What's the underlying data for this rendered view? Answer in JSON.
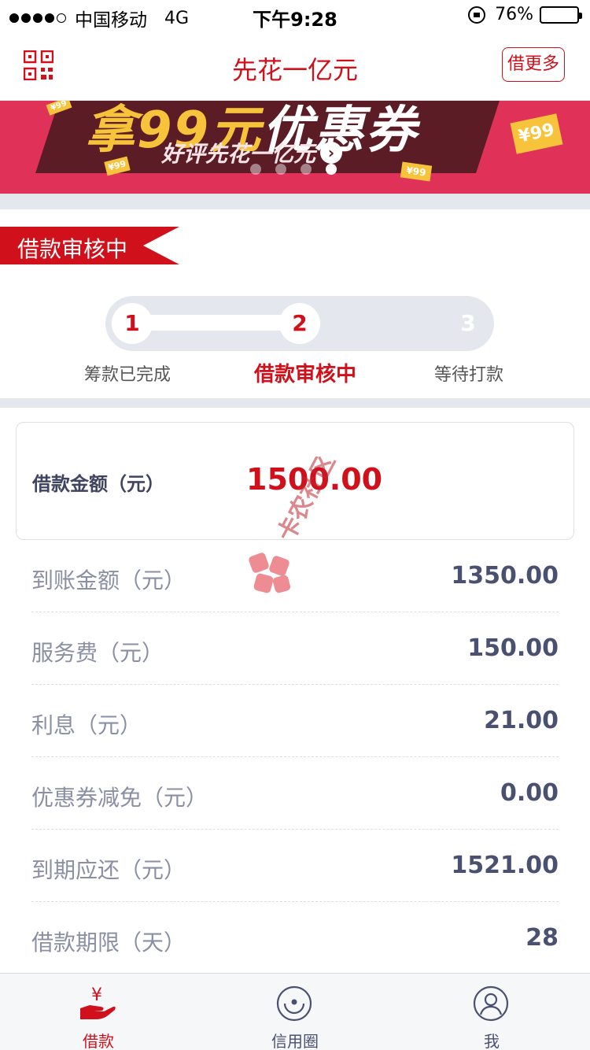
{
  "status_bar": {
    "carrier": "中国移动",
    "network": "4G",
    "time": "下午9:28",
    "battery": "76%",
    "battery_level": 0.76,
    "signal_bars_filled": 4,
    "signal_bars_total": 5
  },
  "nav": {
    "title": "先花一亿元",
    "more_button": "借更多",
    "left_icon": "qr-code-icon"
  },
  "banner": {
    "headline_prefix": "拿99元",
    "headline_suffix": "优惠券",
    "subline": "好评先花一亿元",
    "coupon_big": "¥99",
    "coupon_small": "¥99",
    "page_count": 4,
    "active_page": 4
  },
  "loan_status": {
    "ribbon": "借款审核中",
    "steps": [
      {
        "number": "1",
        "label": "筹款已完成"
      },
      {
        "number": "2",
        "label": "借款审核中"
      },
      {
        "number": "3",
        "label": "等待打款"
      }
    ],
    "current_step": 2
  },
  "amount": {
    "label": "借款金额（元）",
    "value": "1500.00"
  },
  "details": [
    {
      "label": "到账金额（元）",
      "value": "1350.00"
    },
    {
      "label": "服务费（元）",
      "value": "150.00"
    },
    {
      "label": "利息（元）",
      "value": "21.00"
    },
    {
      "label": "优惠券减免（元）",
      "value": "0.00"
    },
    {
      "label": "到期应还（元）",
      "value": "1521.00"
    },
    {
      "label": "借款期限（天）",
      "value": "28"
    }
  ],
  "watermark": "卡农社区",
  "tab_bar": [
    {
      "label": "借款",
      "icon": "yuan-hand-icon",
      "active": true
    },
    {
      "label": "信用圈",
      "icon": "credit-circle-icon",
      "active": false
    },
    {
      "label": "我",
      "icon": "user-icon",
      "active": false
    }
  ],
  "colors": {
    "accent": "#d0111b",
    "banner_bg": "#e03259",
    "banner_stripe": "#5b1c25",
    "gold": "#f6c33a",
    "band": "#e4e8ee",
    "value_text": "#4a5070",
    "label_text": "#8a8fa3"
  }
}
